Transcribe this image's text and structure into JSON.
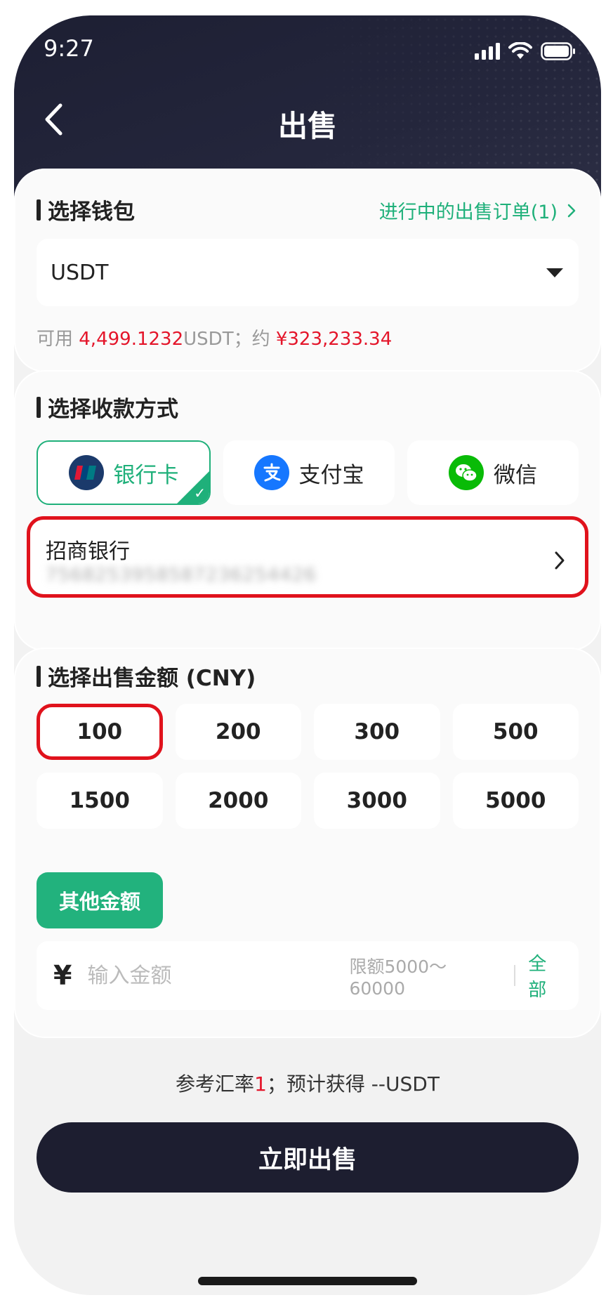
{
  "status": {
    "time": "9:27"
  },
  "header": {
    "title": "出售"
  },
  "wallet": {
    "section_title": "选择钱包",
    "orders_link": "进行中的出售订单(1)",
    "selected": "USDT",
    "balance_prefix": "可用 ",
    "balance_amount": "4,499.1232",
    "balance_unit": "USDT；约 ",
    "balance_cny": "¥323,233.34"
  },
  "payment": {
    "section_title": "选择收款方式",
    "methods": [
      {
        "label": "银行卡",
        "icon": "unionpay-icon",
        "active": true
      },
      {
        "label": "支付宝",
        "icon": "alipay-icon",
        "active": false
      },
      {
        "label": "微信",
        "icon": "wechat-icon",
        "active": false
      }
    ],
    "bank": {
      "name": "招商银行",
      "number": "7568253958587236254426"
    }
  },
  "amount": {
    "section_title": "选择出售金额 (CNY)",
    "options": [
      "100",
      "200",
      "300",
      "500",
      "1500",
      "2000",
      "3000",
      "5000"
    ],
    "selected": "100",
    "other_label": "其他金额",
    "currency_symbol": "¥",
    "input_placeholder": "输入金额",
    "limit_text": "限额5000～60000",
    "all_label": "全部"
  },
  "footer": {
    "rate_prefix": "参考汇率",
    "rate_value": "1",
    "rate_suffix": "；预计获得 --USDT",
    "submit_label": "立即出售"
  },
  "colors": {
    "accent_green": "#1fb07a",
    "highlight_red": "#e0121c",
    "header_dark": "#1d1f33",
    "button_dark": "#1d1e30"
  }
}
